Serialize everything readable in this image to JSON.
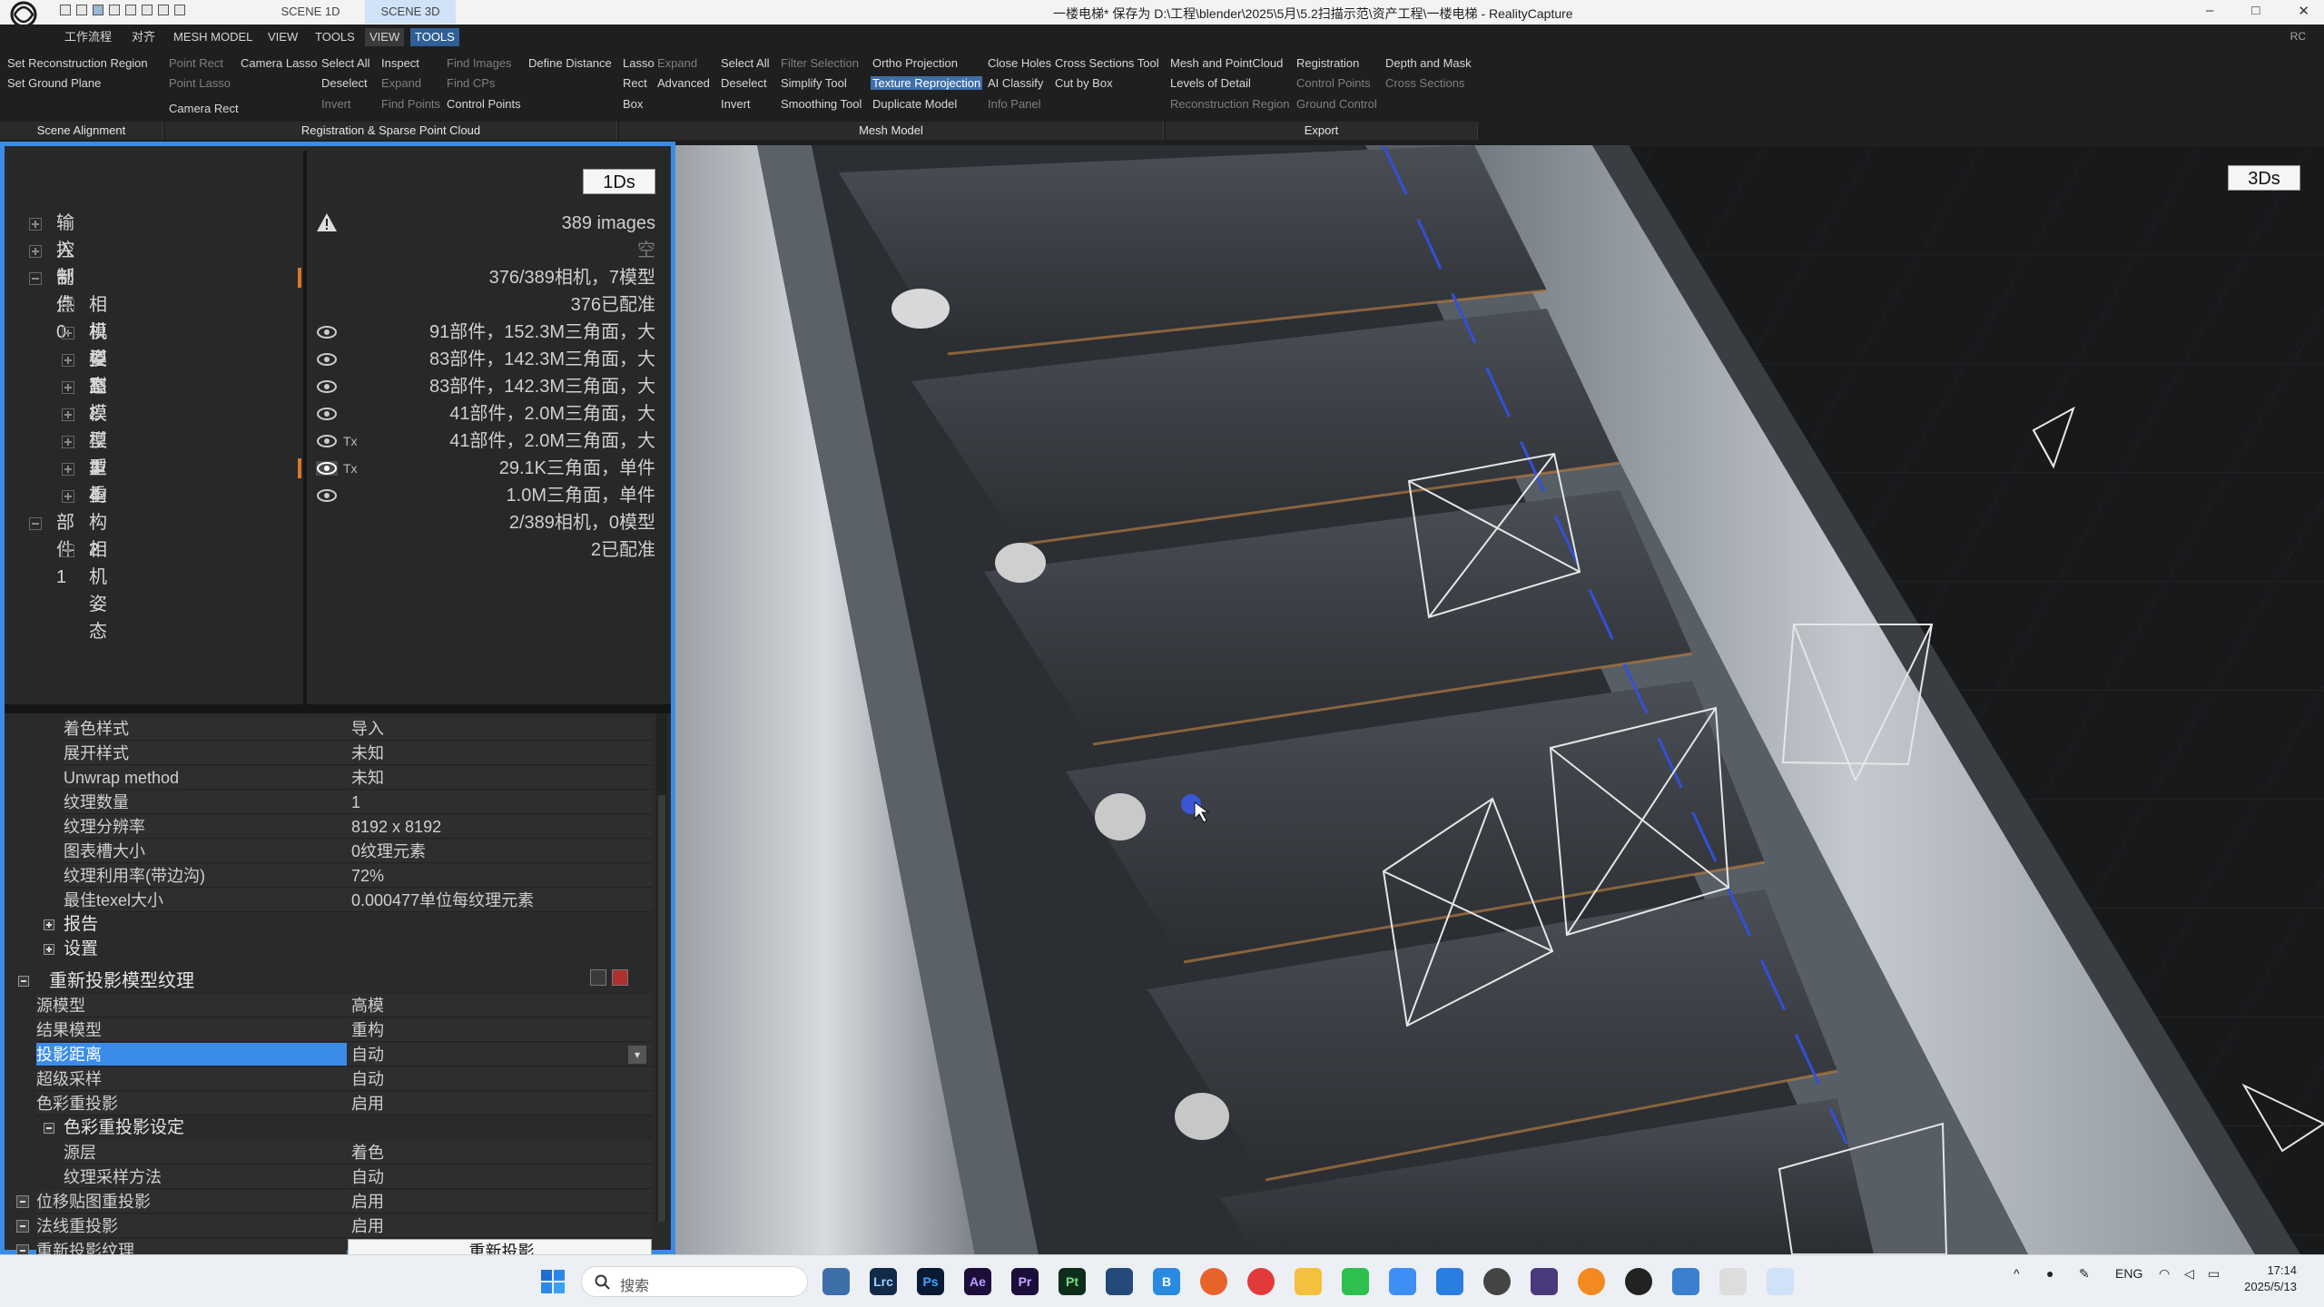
{
  "titlebar": {
    "scene_tabs": [
      "SCENE 1D",
      "SCENE 3D"
    ],
    "title": "一楼电梯* 保存为 D:\\工程\\blender\\2025\\5月\\5.2扫描示范\\资产工程\\一楼电梯 - RealityCapture",
    "window_buttons": [
      "–",
      "□",
      "✕"
    ]
  },
  "menu": {
    "items": [
      "工作流程",
      "对齐",
      "MESH MODEL",
      "VIEW",
      "TOOLS",
      "VIEW",
      "TOOLS"
    ],
    "rc": "RC"
  },
  "ribbon": {
    "set_reconstruction_region": "Set Reconstruction Region",
    "set_ground_plane": "Set Ground Plane",
    "point_rect": "Point Rect",
    "point_lasso": "Point Lasso",
    "camera_rect": "Camera Rect",
    "camera_lasso": "Camera Lasso",
    "select_all_1": "Select All",
    "deselect_1": "Deselect",
    "invert_1": "Invert",
    "inspect": "Inspect",
    "expand_1": "Expand",
    "find_points": "Find Points",
    "find_images": "Find Images",
    "find_cps": "Find CPs",
    "control_points_1": "Control Points",
    "define_distance": "Define Distance",
    "lasso": "Lasso",
    "rect": "Rect",
    "box": "Box",
    "expand_2": "Expand",
    "advanced": "Advanced",
    "select_all_2": "Select All",
    "deselect_2": "Deselect",
    "invert_2": "Invert",
    "filter_selection": "Filter Selection",
    "simplify_tool": "Simplify Tool",
    "smoothing_tool": "Smoothing Tool",
    "ortho_projection": "Ortho Projection",
    "texture_reprojection": "Texture Reprojection",
    "duplicate_model": "Duplicate Model",
    "close_holes": "Close Holes",
    "ai_classify": "AI Classify",
    "info_panel": "Info Panel",
    "cross_sections_tool": "Cross Sections Tool",
    "cut_by_box": "Cut by Box",
    "mesh_and_pointcloud": "Mesh and PointCloud",
    "levels_of_detail": "Levels of Detail",
    "reconstruction_region": "Reconstruction Region",
    "registration": "Registration",
    "control_points_2": "Control Points",
    "ground_control": "Ground Control",
    "depth_and_mask": "Depth and Mask",
    "cross_sections": "Cross Sections",
    "groups": {
      "scene_alignment": "Scene Alignment",
      "registration": "Registration & Sparse Point Cloud",
      "mesh_model": "Mesh Model",
      "export": "Export"
    }
  },
  "left_panel": {
    "badge": "1Ds",
    "tree": [
      {
        "label": "输入",
        "value": "389 images"
      },
      {
        "label": "控制点",
        "value": "空"
      },
      {
        "label": "部件0",
        "value": "376/389相机，7模型"
      },
      {
        "label": "相机姿态",
        "value": "376已配准"
      },
      {
        "label": "模型1",
        "value": "91部件，152.3M三角面，大"
      },
      {
        "label": "模型2",
        "value": "83部件，142.3M三角面，大"
      },
      {
        "label": "高模",
        "value": "83部件，142.3M三角面，大"
      },
      {
        "label": "模型3",
        "value": "41部件，2.0M三角面，大"
      },
      {
        "label": "模型4",
        "value": "41部件，2.0M三角面，大"
      },
      {
        "label": "重构",
        "value": "29.1K三角面，单件"
      },
      {
        "label": "重构2",
        "value": "1.0M三角面，单件"
      },
      {
        "label": "部件1",
        "value": "2/389相机，0模型"
      },
      {
        "label": "相机姿态",
        "value": "2已配准"
      }
    ],
    "tx_label": "Tx",
    "properties_top": [
      {
        "k": "着色样式",
        "v": "导入"
      },
      {
        "k": "展开样式",
        "v": "未知"
      },
      {
        "k": "Unwrap method",
        "v": "未知"
      },
      {
        "k": "纹理数量",
        "v": "1"
      },
      {
        "k": "纹理分辨率",
        "v": "8192 x 8192"
      },
      {
        "k": "图表槽大小",
        "v": "0纹理元素"
      },
      {
        "k": "纹理利用率(带边沟)",
        "v": "72%"
      },
      {
        "k": "最佳texel大小",
        "v": "0.000477单位每纹理元素"
      }
    ],
    "sections": {
      "report": "报告",
      "settings": "设置"
    },
    "reproject_panel": {
      "title": "重新投影模型纹理",
      "rows": [
        {
          "k": "源模型",
          "v": "高模"
        },
        {
          "k": "结果模型",
          "v": "重构"
        },
        {
          "k": "投影距离",
          "v": "自动"
        },
        {
          "k": "超级采样",
          "v": "自动"
        },
        {
          "k": "色彩重投影",
          "v": "启用"
        }
      ],
      "color_section": "色彩重投影设定",
      "color_rows": [
        {
          "k": "源层",
          "v": "着色"
        },
        {
          "k": "纹理采样方法",
          "v": "自动"
        }
      ],
      "bottom_rows": [
        {
          "k": "位移贴图重投影",
          "v": "启用"
        },
        {
          "k": "法线重投影",
          "v": "启用"
        }
      ],
      "action_label": "重新投影纹理",
      "action_button": "重新投影"
    }
  },
  "viewport": {
    "badge": "3Ds"
  },
  "taskbar": {
    "search_placeholder": "搜索",
    "icons": [
      "Lrc",
      "Ps",
      "Ae",
      "Pr",
      "Pt",
      "B"
    ],
    "lang": "ENG",
    "time": "17:14",
    "date": "2025/5/13"
  }
}
